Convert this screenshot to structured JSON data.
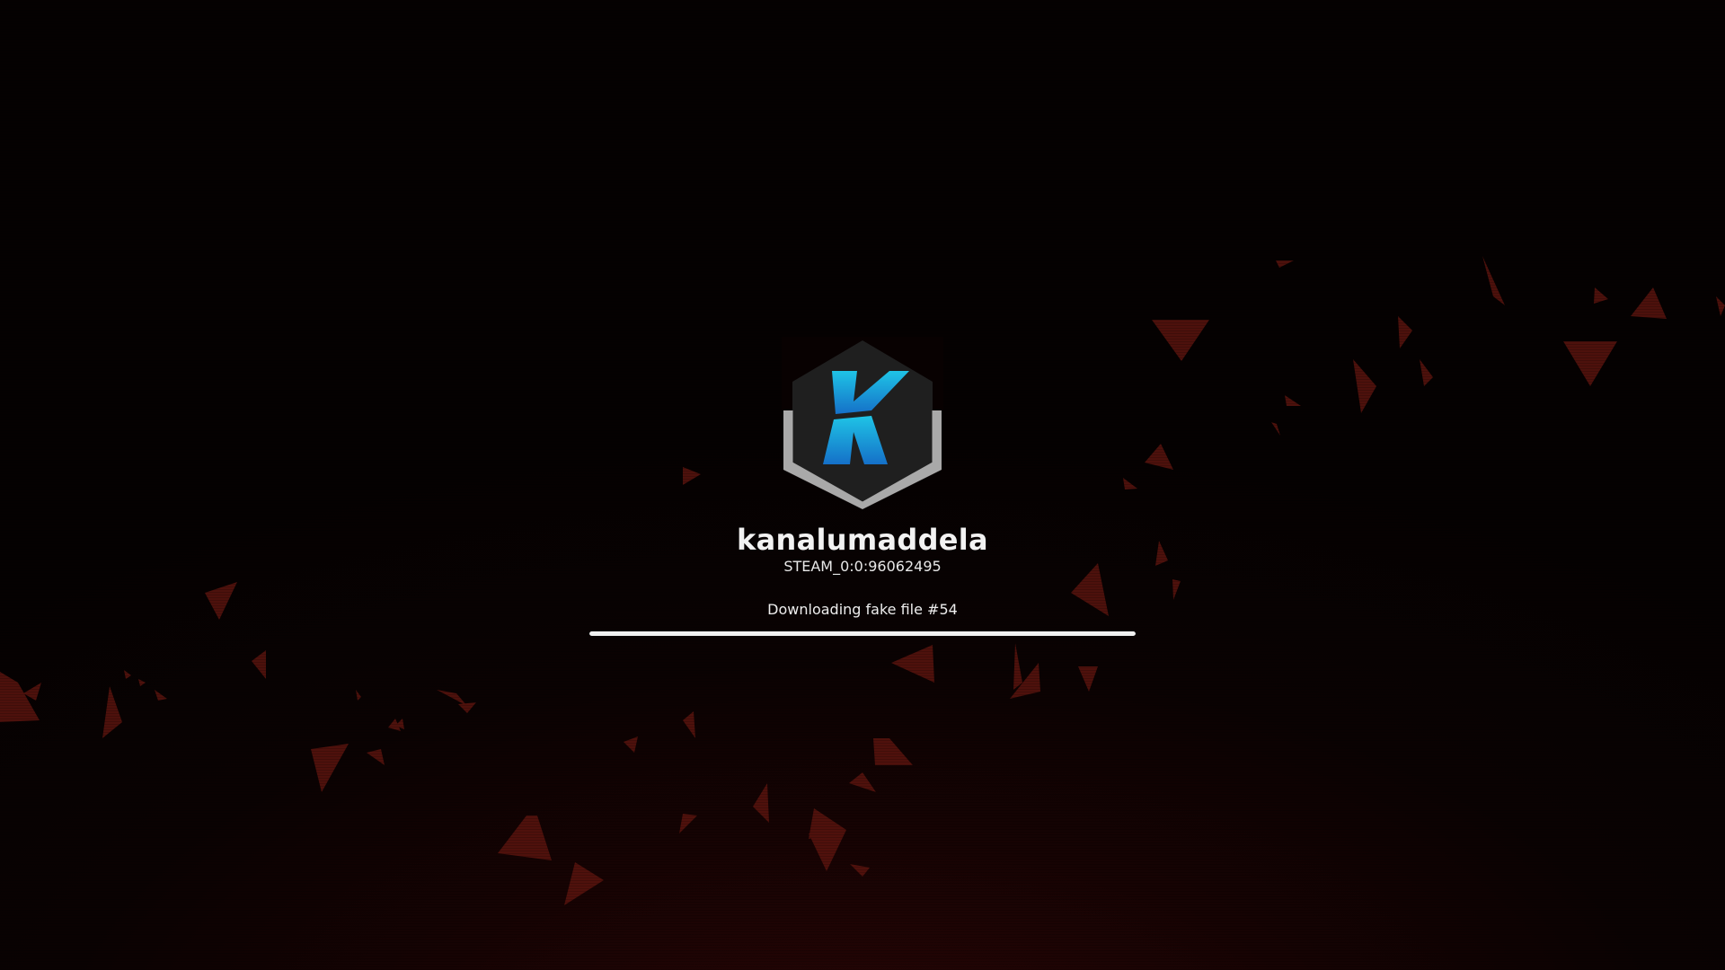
{
  "player": {
    "name": "kanalumaddela",
    "steam_id": "STEAM_0:0:96062495"
  },
  "logo": {
    "letter": "K",
    "icon": "k-hexagon-logo-icon"
  },
  "loading": {
    "status_text": "Downloading fake file #54",
    "progress": 1.0
  },
  "colors": {
    "shard": "#5a140e",
    "logo_blue_top": "#1fc4e6",
    "logo_blue_bottom": "#1570c8",
    "hex_dark": "#1f1f1f",
    "hex_rim": "#a9a9a9"
  }
}
